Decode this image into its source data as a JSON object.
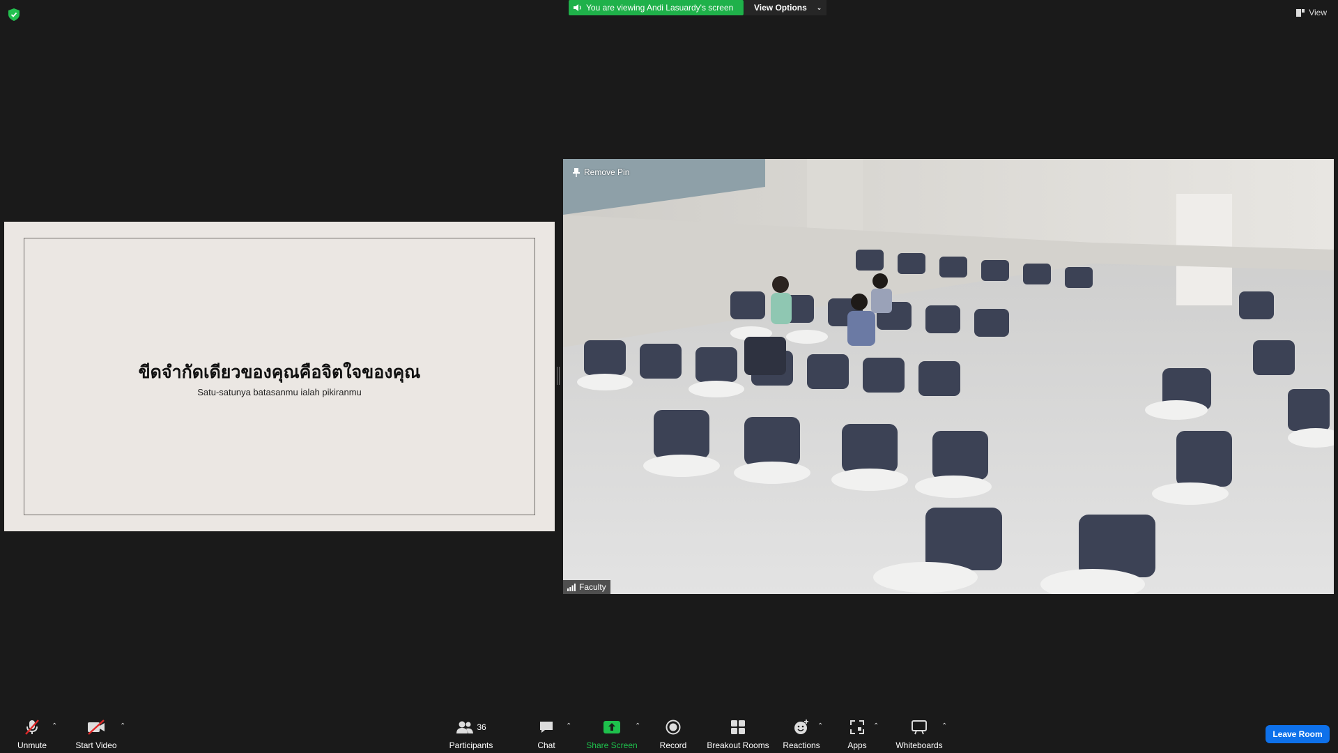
{
  "top": {
    "banner_text": "You are viewing Andi Lasuardy's screen",
    "view_options": "View Options",
    "view_label": "View"
  },
  "slide": {
    "title": "ขีดจำกัดเดียวของคุณคือจิตใจของคุณ",
    "subtitle": "Satu-satunya batasanmu ialah pikiranmu"
  },
  "video": {
    "remove_pin": "Remove Pin",
    "participant_name": "Faculty"
  },
  "toolbar": {
    "unmute": "Unmute",
    "start_video": "Start Video",
    "participants": "Participants",
    "participant_count": "36",
    "chat": "Chat",
    "share_screen": "Share Screen",
    "record": "Record",
    "breakout_rooms": "Breakout Rooms",
    "reactions": "Reactions",
    "apps": "Apps",
    "whiteboards": "Whiteboards",
    "leave": "Leave Room"
  },
  "colors": {
    "share_green": "#1fb14a",
    "leave_blue": "#0e71eb",
    "mute_red": "#e02828"
  }
}
